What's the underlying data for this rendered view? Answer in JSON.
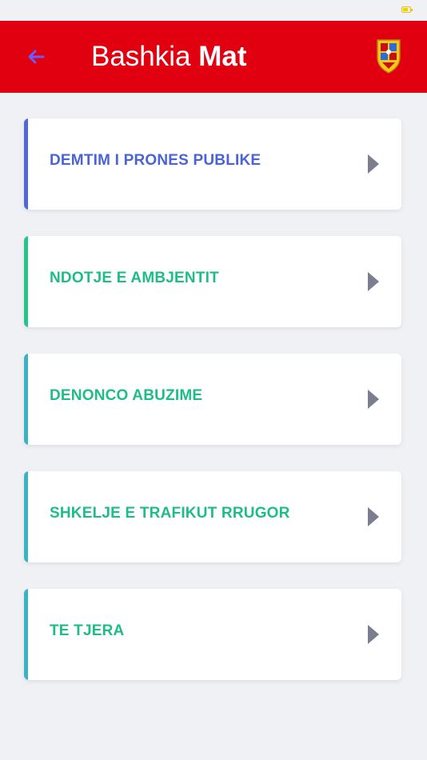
{
  "header": {
    "title_regular": "Bashkia ",
    "title_bold": "Mat",
    "back_icon": "arrow-left-icon",
    "crest_icon": "municipal-crest-icon",
    "background_color": "#e1000f",
    "back_icon_color": "#6a5cff"
  },
  "categories": [
    {
      "label": "DEMTIM I PRONES PUBLIKE",
      "color": "#4a63d6"
    },
    {
      "label": "NDOTJE E AMBJENTIT",
      "color": "#1fbd86"
    },
    {
      "label": "DENONCO ABUZIME",
      "color": "#1fbd86"
    },
    {
      "label": "SHKELJE E TRAFIKUT RRUGOR",
      "color": "#1fbd86"
    },
    {
      "label": "TE TJERA",
      "color": "#1fbd86"
    }
  ],
  "accent_colors": [
    "#5068d8",
    "#27c48a",
    "#3ab4c4",
    "#3ab4c4",
    "#3ab4c4"
  ],
  "chevron_icon": "chevron-right-icon"
}
